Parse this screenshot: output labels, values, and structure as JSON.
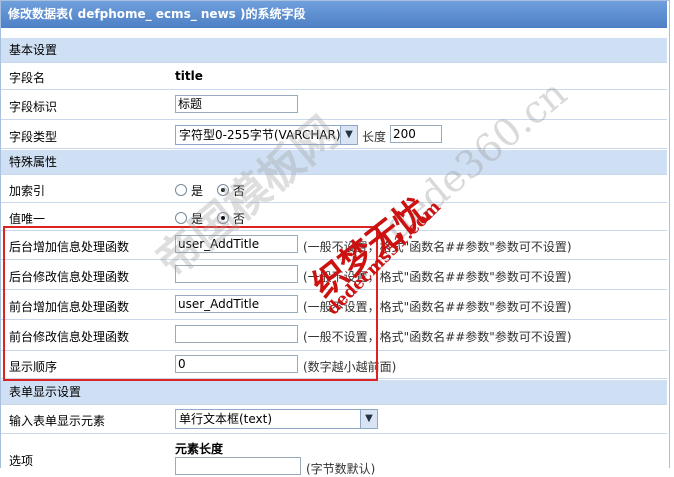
{
  "title": "修改数据表( defphome_ ecms_ news )的系统字段",
  "sections": {
    "basic": "基本设置",
    "special": "特殊属性",
    "form": "表单显示设置"
  },
  "fields": {
    "name_label": "字段名",
    "name_value": "title",
    "id_label": "字段标识",
    "id_value": "标题",
    "type_label": "字段类型",
    "type_value": "字符型0-255字节(VARCHAR)",
    "length_label": "长度",
    "length_value": "200",
    "index_label": "加索引",
    "unique_label": "值唯一",
    "yes": "是",
    "no": "否",
    "admin_add_label": "后台增加信息处理函数",
    "admin_add_value": "user_AddTitle",
    "admin_edit_label": "后台修改信息处理函数",
    "admin_edit_value": "",
    "front_add_label": "前台增加信息处理函数",
    "front_add_value": "user_AddTitle",
    "front_edit_label": "前台修改信息处理函数",
    "front_edit_value": "",
    "func_hint": "(一般不设置，格式\"函数名##参数\"参数可不设置)",
    "order_label": "显示顺序",
    "order_value": "0",
    "order_hint": "(数字越小越前面)",
    "element_label": "输入表单显示元素",
    "element_value": "单行文本框(text)",
    "options_label": "选项",
    "element_length_label": "元素长度",
    "element_length_hint": "(字节数默认)"
  },
  "watermarks": {
    "site1": "帝国模板网",
    "site2": "dede360.cn",
    "brand": "织梦无忧",
    "site3": "dedecms51.com"
  },
  "colors": {
    "title_bar": "#5a8cd0",
    "section_bg": "#cfe0f4",
    "highlight_border": "#dd2222",
    "watermark_red": "#cc1111"
  }
}
